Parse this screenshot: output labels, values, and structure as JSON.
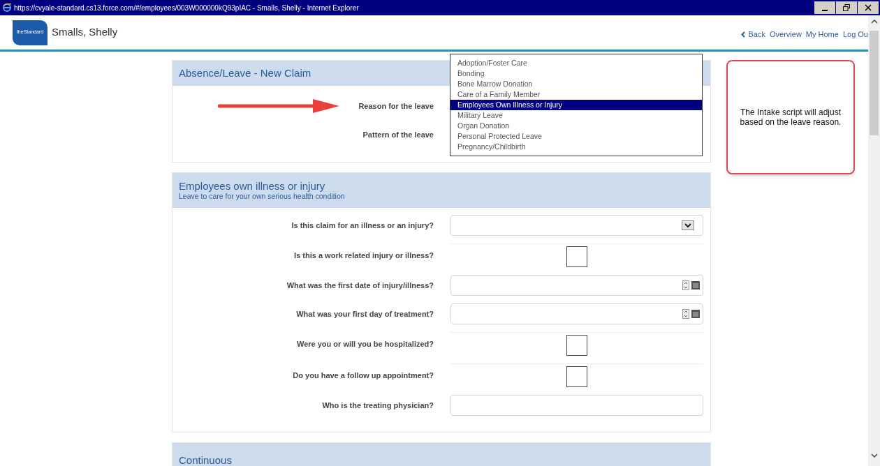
{
  "window": {
    "title": "https://cvyale-standard.cs13.force.com/#/employees/003W000000kQ93pIAC - Smalls, Shelly - Internet Explorer"
  },
  "header": {
    "logo_text": "theStandard",
    "user_name": "Smalls, Shelly",
    "nav": [
      {
        "label": "Back",
        "kind": "back"
      },
      {
        "label": "Overview",
        "kind": "link"
      },
      {
        "label": "My Home",
        "kind": "link"
      },
      {
        "label": "Log Ou",
        "kind": "link"
      }
    ]
  },
  "claim_card": {
    "title": "Absence/Leave - New Claim",
    "fields": [
      {
        "label": "Reason for the leave"
      },
      {
        "label": "Pattern of the leave"
      }
    ],
    "dropdown": {
      "options": [
        {
          "label": "Adoption/Foster Care",
          "selected": false
        },
        {
          "label": "Bonding",
          "selected": false
        },
        {
          "label": "Bone Marrow Donation",
          "selected": false
        },
        {
          "label": "Care of a Family Member",
          "selected": false
        },
        {
          "label": "Employees Own Illness or Injury",
          "selected": true
        },
        {
          "label": "Military Leave",
          "selected": false
        },
        {
          "label": "Organ Donation",
          "selected": false
        },
        {
          "label": "Personal Protected Leave",
          "selected": false
        },
        {
          "label": "Pregnancy/Childbirth",
          "selected": false
        }
      ]
    }
  },
  "sections": [
    {
      "title": "Employees own illness or injury",
      "subtitle": "Leave to care for your own serious health condition",
      "fields": [
        {
          "label": "Is this claim for an illness or an injury?",
          "kind": "select"
        },
        {
          "label": "Is this a work related injury or illness?",
          "kind": "checkbox",
          "checked": false
        },
        {
          "label": "What was the first date of injury/illness?",
          "kind": "date"
        },
        {
          "label": "What was your first day of treatment?",
          "kind": "date"
        },
        {
          "label": "Were you or will you be hospitalized?",
          "kind": "checkbox",
          "checked": false
        },
        {
          "label": "Do you have a follow up appointment?",
          "kind": "checkbox",
          "checked": false
        },
        {
          "label": "Who is the treating physician?",
          "kind": "text"
        }
      ]
    },
    {
      "title": "Continuous"
    }
  ],
  "callout": {
    "text": "The Intake script will adjust based on the leave reason."
  }
}
